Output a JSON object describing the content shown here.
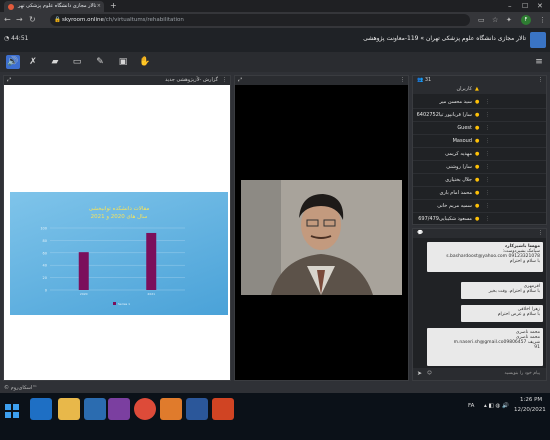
{
  "browser": {
    "tab_title": "تالار مجازی دانشگاه علوم پزشکی تهر",
    "tab_close": "×",
    "new_tab": "+",
    "url_host": "skyroom.online",
    "url_path": "/ch/virtualtums/rehabilitation",
    "avatar_letter": "F"
  },
  "room": {
    "clock": "44:51",
    "title": "تالار مجازی دانشگاه علوم پزشکی تهران » 119-معاونت پژوهشی"
  },
  "slides_panel": {
    "title": "گزارش -لأزپژوهشی جدید",
    "slide_title_1": "مقالات دانشکده توانبخشی",
    "slide_title_2": "سال های 2020 و 2021",
    "chart_data": {
      "type": "bar",
      "categories": [
        "2020",
        "2021"
      ],
      "values": [
        61,
        92
      ],
      "ylim": [
        0,
        100
      ],
      "yticks": [
        0,
        20,
        40,
        60,
        80,
        100
      ],
      "legend": "Series 1",
      "bar_color": "#7b0f5c",
      "title": "",
      "xlabel": "",
      "ylabel": ""
    }
  },
  "users_panel": {
    "count": "31",
    "title": "کاربران",
    "users": [
      "سید محسن میر",
      "سارا قربانپور تیا6402752",
      "Guest",
      "Masoud",
      "مهدیه کریمی",
      "سارا روشنی",
      "جلال بختیاری",
      "محمد امام باری",
      "سمیه مریم خانی",
      "مسعود شکیبایی697/479"
    ]
  },
  "chat_panel": {
    "messages": [
      {
        "name": "مهسا باشیرکارد",
        "lines": [
          "سیامک بشیردوست:",
          "s.bashardoost@yahoo.com 09123321078",
          "با سلام و احترام"
        ]
      },
      {
        "name": "",
        "lines": [
          "اقرمهری",
          "با سلام و احترام. وقت بخیر"
        ]
      },
      {
        "name": "",
        "lines": [
          "زهرا اخلاقی",
          "با سلام و عرض احترام"
        ]
      },
      {
        "name": "",
        "lines": [
          "محمد ناصری",
          "محمد ناصری",
          "شریف m.naseri.sh@gmail.co09806457",
          "91"
        ]
      }
    ],
    "input_placeholder": "پیام خود را بنویسید"
  },
  "statusbar": {
    "left": "© اسکای‌روم™"
  },
  "taskbar": {
    "lang": "FA",
    "time": "1:26 PM",
    "date": "12/20/2021"
  }
}
